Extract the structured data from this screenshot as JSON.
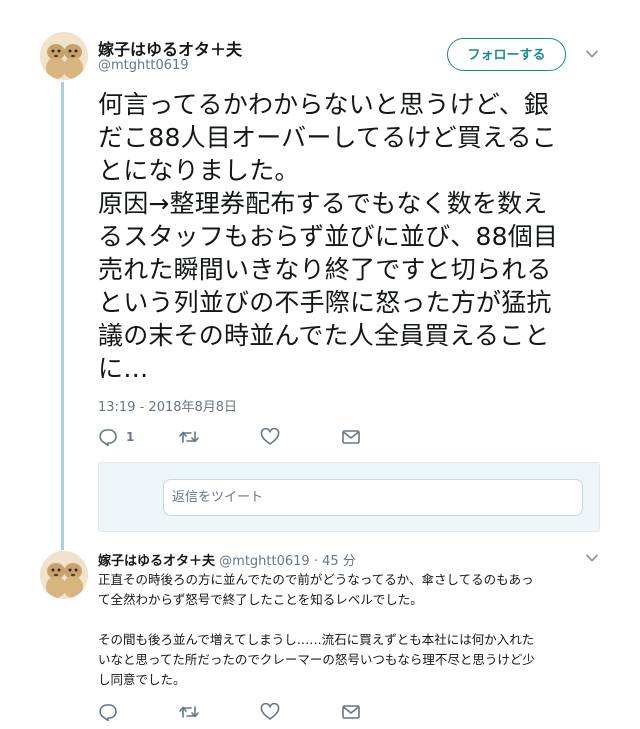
{
  "tweet": {
    "display_name": "嫁子はゆるオタ＋夫",
    "handle": "@mtghtt0619",
    "follow_label": "フォローする",
    "text_lines": [
      "何言ってるかわからないと思うけど、銀",
      "だこ88人目オーバーしてるけど買えるこ",
      "とになりました。",
      "原因→整理券配布するでもなく数を数え",
      "るスタッフもおらず並びに並び、88個目",
      "売れた瞬間いきなり終了ですと切られる",
      "という列並びの不手際に怒った方が猛抗",
      "議の末その時並んでた人全員買えること",
      "に…"
    ],
    "timestamp": "13:19 - 2018年8月8日",
    "reply_count": "1",
    "icons": [
      "reply-icon",
      "retweet-icon",
      "like-icon",
      "message-icon",
      "chevron-down-icon"
    ]
  },
  "reply_composer": {
    "placeholder": "返信をツイート"
  },
  "reply_tweet": {
    "display_name": "嫁子はゆるオタ＋夫",
    "handle": "@mtghtt0619",
    "separator": "·",
    "time_ago": "45 分",
    "text_lines": [
      "正直その時後ろの方に並んでたので前がどうなってるか、傘さしてるのもあっ",
      "て全然わからず怒号で終了したことを知るレベルでした。",
      "",
      "その間も後ろ並んで増えてしまうし……流石に買えずとも本社には何か入れた",
      "いなと思ってた所だったのでクレーマーの怒号いつもなら理不尽と思うけど少",
      "し同意でした。"
    ]
  },
  "colors": {
    "accent": "#1a8a92",
    "thread_line": "#a6d4d8",
    "muted_text": "#657786",
    "composer_bg": "#eef5f6"
  }
}
